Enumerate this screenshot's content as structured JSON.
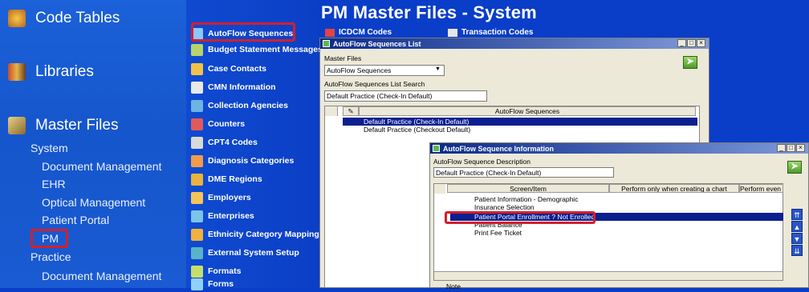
{
  "left_nav": {
    "code_tables": "Code Tables",
    "libraries": "Libraries",
    "master_files": "Master Files",
    "system": "System",
    "document_management": "Document Management",
    "ehr": "EHR",
    "optical_management": "Optical Management",
    "patient_portal": "Patient Portal",
    "pm": "PM",
    "practice": "Practice",
    "practice_document_management": "Document Management"
  },
  "mid_list": [
    "AutoFlow Sequences",
    "Budget Statement Messages",
    "Case Contacts",
    "CMN Information",
    "Collection Agencies",
    "Counters",
    "CPT4 Codes",
    "Diagnosis Categories",
    "DME Regions",
    "Employers",
    "Enterprises",
    "Ethnicity Category Mapping",
    "External System Setup",
    "Formats",
    "Forms"
  ],
  "page_title": "PM Master Files - System",
  "tabs": {
    "icdcm": "ICDCM Codes",
    "transaction": "Transaction Codes"
  },
  "win1": {
    "title": "AutoFlow Sequences List",
    "master_files_label": "Master Files",
    "master_files_value": "AutoFlow Sequences",
    "search_label": "AutoFlow Sequences List Search",
    "search_value": "Default Practice (Check-In Default)",
    "column": "AutoFlow Sequences",
    "rows": [
      "Default Practice (Check-In Default)",
      "Default Practice (Checkout Default)"
    ]
  },
  "win2": {
    "title": "AutoFlow Sequence Information",
    "desc_label": "AutoFlow Sequence Description",
    "desc_value": "Default Practice (Check-In Default)",
    "col1": "Screen/Item",
    "col2": "Perform only when creating a chart",
    "col3": "Perform even i",
    "rows": [
      "Patient Information - Demographic",
      "Insurance Selection",
      "Patient Portal Enrollment ? Not Enrolled",
      "Patient Balance",
      "Print Fee Ticket"
    ],
    "note_label": "Note"
  },
  "colors": {
    "nav_bg": "#1656cc",
    "desktop_bg": "#0a3ec8",
    "highlight": "#d3202a",
    "selection": "#0b1f8f"
  }
}
